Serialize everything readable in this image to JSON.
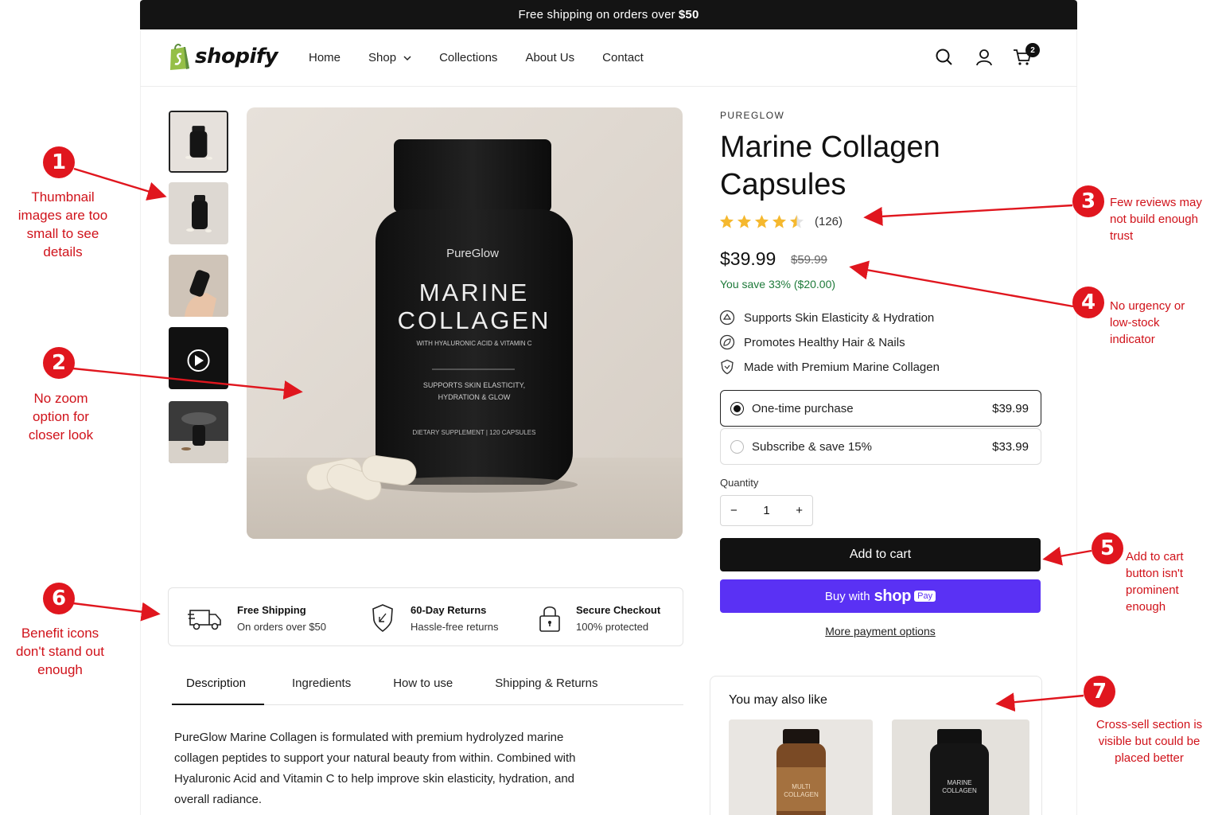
{
  "announcement": {
    "text": "Free shipping on orders over",
    "highlight": "$50"
  },
  "header": {
    "logo_text": "shopify",
    "nav": [
      "Home",
      "Shop",
      "Collections",
      "About Us",
      "Contact"
    ],
    "cart_count": "2",
    "icons": [
      "search-icon",
      "account-icon",
      "cart-icon"
    ]
  },
  "gallery": {
    "thumbnails": [
      "bottle-front",
      "bottle-angle",
      "bottle-in-hand",
      "video",
      "bottle-dark-scene"
    ],
    "main_image": {
      "brand": "PureGlow",
      "line1": "MARINE",
      "line2": "COLLAGEN",
      "sub": "WITH HYALURONIC ACID & VITAMIN C",
      "claim1": "SUPPORTS SKIN ELASTICITY,",
      "claim2": "HYDRATION & GLOW",
      "footer": "DIETARY SUPPLEMENT | 120 CAPSULES"
    }
  },
  "product": {
    "brand": "PUREGLOW",
    "title": "Marine Collagen Capsules",
    "rating": 4.5,
    "review_count": "(126)",
    "price": "$39.99",
    "compare_price": "$59.99",
    "savings": "You save 33% ($20.00)",
    "benefits": [
      "Supports Skin Elasticity & Hydration",
      "Promotes Healthy Hair & Nails",
      "Made with Premium Marine Collagen"
    ],
    "options": [
      {
        "label": "One-time purchase",
        "price": "$39.99",
        "selected": true
      },
      {
        "label": "Subscribe & save 15%",
        "price": "$33.99",
        "selected": false
      }
    ],
    "quantity_label": "Quantity",
    "quantity": "1",
    "add_to_cart": "Add to cart",
    "buy_with": "Buy with",
    "shop_word": "shop",
    "pay_word": "Pay",
    "more_payment": "More payment options"
  },
  "benefit_bar": [
    {
      "title": "Free Shipping",
      "sub": "On orders over $50",
      "icon": "truck-icon"
    },
    {
      "title": "60-Day Returns",
      "sub": "Hassle-free returns",
      "icon": "shield-return-icon"
    },
    {
      "title": "Secure Checkout",
      "sub": "100% protected",
      "icon": "lock-icon"
    }
  ],
  "tabs": [
    "Description",
    "Ingredients",
    "How to use",
    "Shipping & Returns"
  ],
  "active_tab": "Description",
  "description": "PureGlow Marine Collagen is formulated with premium hydrolyzed marine collagen peptides to support your natural beauty from within. Combined with Hyaluronic Acid and Vitamin C to help improve skin elasticity, hydration, and overall radiance.",
  "cross_sell": {
    "title": "You may also like",
    "items": [
      {
        "label1": "MULTI",
        "label2": "COLLAGEN"
      },
      {
        "label1": "MARINE",
        "label2": "COLLAGEN"
      }
    ]
  },
  "annotations": [
    {
      "n": "1",
      "lines": [
        "Thumbnail",
        "images are too",
        "small to see",
        "details"
      ]
    },
    {
      "n": "2",
      "lines": [
        "No zoom",
        "option for",
        "closer look"
      ]
    },
    {
      "n": "3",
      "lines": [
        "Few reviews may",
        "not build enough",
        "trust"
      ]
    },
    {
      "n": "4",
      "lines": [
        "No urgency or",
        "low-stock",
        "indicator"
      ]
    },
    {
      "n": "5",
      "lines": [
        "Add to cart",
        "button isn't",
        "prominent",
        "enough"
      ]
    },
    {
      "n": "6",
      "lines": [
        "Benefit icons",
        "don't stand out",
        "enough"
      ]
    },
    {
      "n": "7",
      "lines": [
        "Cross-sell section is",
        "visible but could be",
        "placed better"
      ]
    }
  ],
  "colors": {
    "accent_red": "#e0161e",
    "shop_pay": "#5a31f4",
    "savings_green": "#1e7a3a",
    "star": "#f5b82e"
  }
}
